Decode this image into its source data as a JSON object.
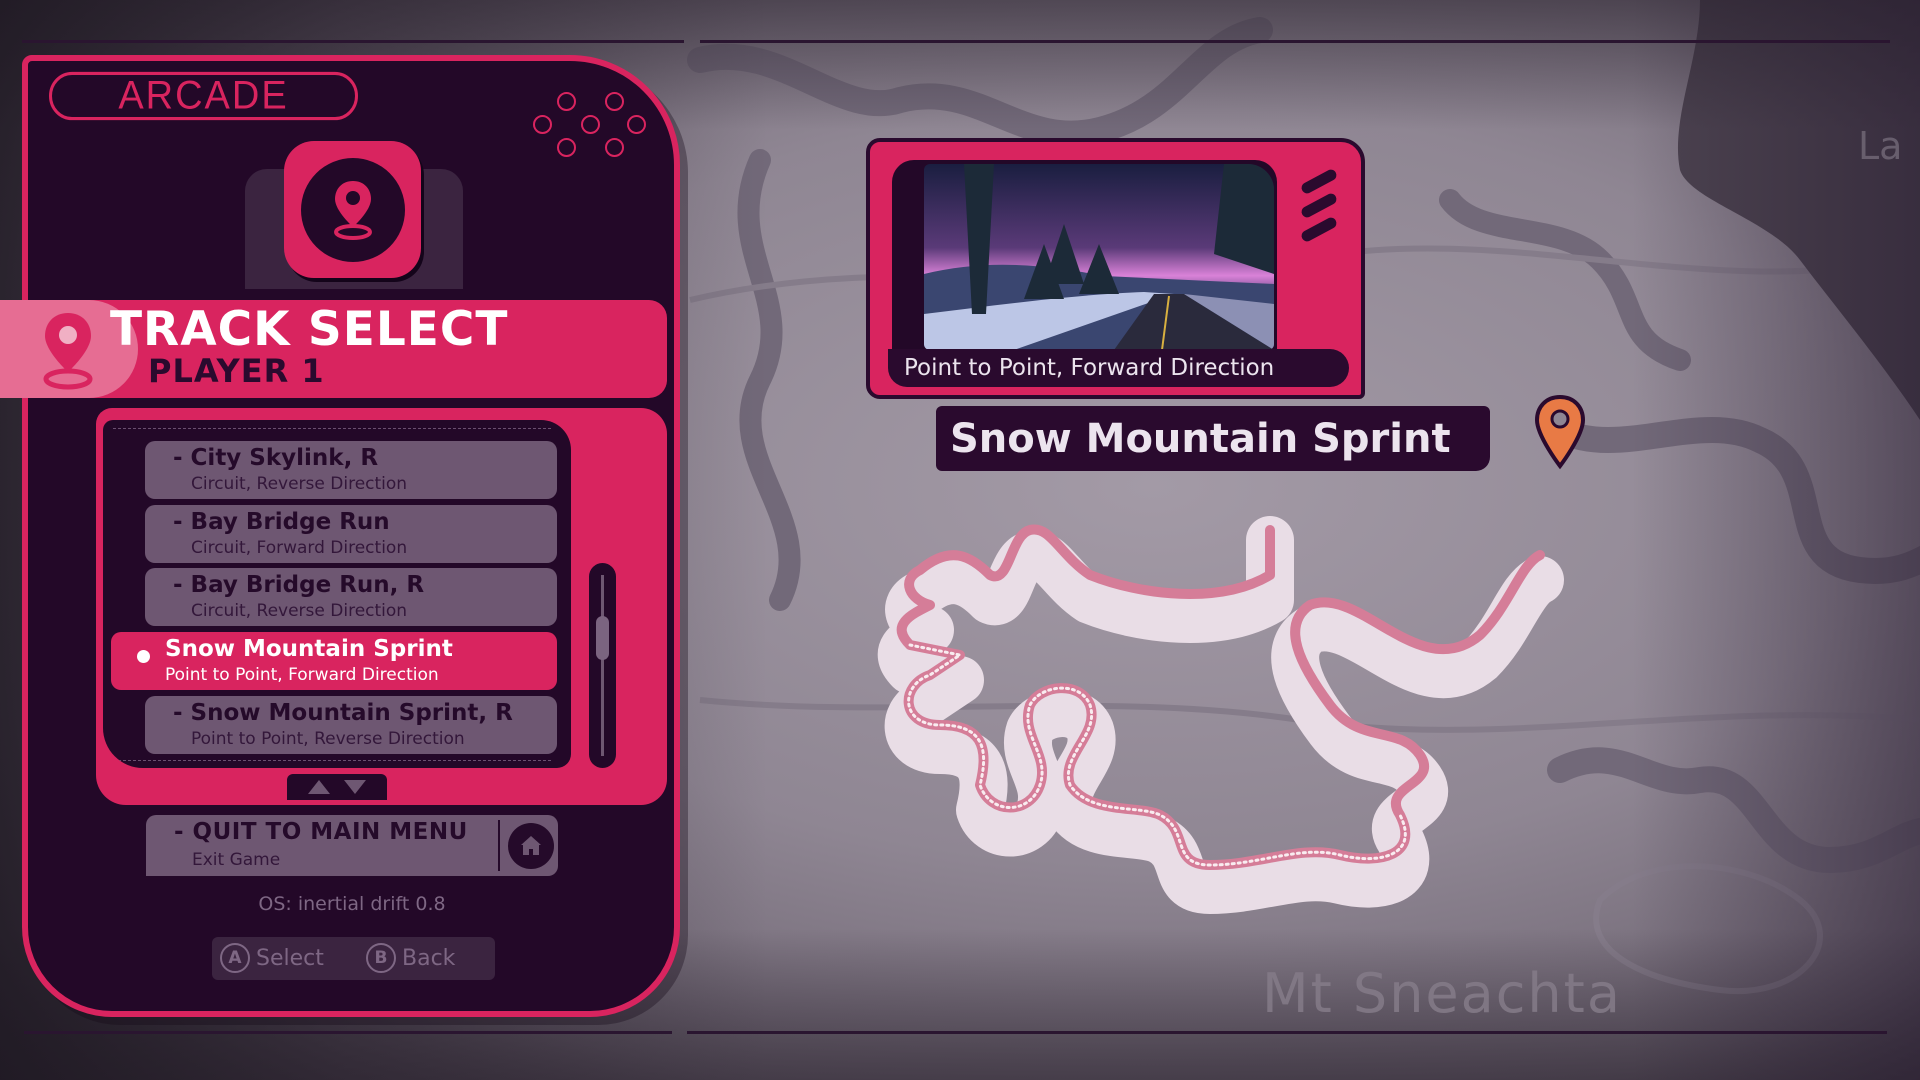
{
  "mode_label": "ARCADE",
  "header": {
    "title": "TRACK SELECT",
    "subtitle": "PLAYER 1"
  },
  "track_list": {
    "items": [
      {
        "title": "- City Skylink, R",
        "subtitle": "Circuit, Reverse Direction",
        "selected": false
      },
      {
        "title": "- Bay Bridge Run",
        "subtitle": "Circuit, Forward Direction",
        "selected": false
      },
      {
        "title": "- Bay Bridge Run, R",
        "subtitle": "Circuit, Reverse Direction",
        "selected": false
      },
      {
        "title": "Snow Mountain Sprint",
        "subtitle": "Point to Point, Forward Direction",
        "selected": true
      },
      {
        "title": "- Snow Mountain Sprint, R",
        "subtitle": "Point to Point, Reverse Direction",
        "selected": false
      }
    ],
    "scroll_position": 0.3
  },
  "quit": {
    "title": "- QUIT TO MAIN MENU",
    "subtitle": "Exit Game",
    "icon": "home-icon"
  },
  "version": "OS: inertial drift 0.8",
  "hints": {
    "select_key": "A",
    "select_label": "Select",
    "back_key": "B",
    "back_label": "Back"
  },
  "preview": {
    "caption": "Point to Point, Forward Direction",
    "track_name": "Snow Mountain Sprint"
  },
  "map": {
    "region_label": "Mt Sneachta",
    "partial_label": "La"
  },
  "colors": {
    "accent": "#d9245f",
    "panel": "#230828",
    "item": "#6e5772",
    "pin": "#e87a45"
  }
}
